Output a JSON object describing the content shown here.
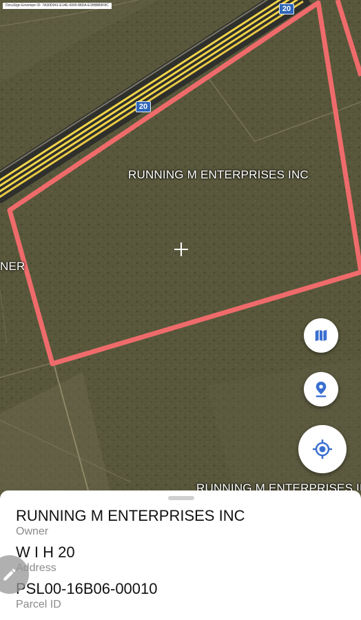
{
  "map": {
    "docusign_text": "DocuSign Envelope ID: 7A30D941-E14E-4300-88DA-E1B8B89F8C",
    "parcel_owner_main": "RUNNING M ENTERPRISES INC",
    "parcel_owner_left_partial": "NER",
    "parcel_owner_bottom_partial": "RUNNING M ENTERPRISES INC",
    "highway_top": "20",
    "highway_mid": "20",
    "colors": {
      "parcel_outline": "#ef6b6b",
      "road": "#f1d54a",
      "accent": "#2f66b8"
    }
  },
  "buttons": {
    "map_layers_icon": "map-icon",
    "pin_icon": "location-pin-icon",
    "locate_icon": "my-location-icon",
    "edit_icon": "pencil-icon"
  },
  "sheet": {
    "owner_value": "RUNNING M ENTERPRISES INC",
    "owner_label": "Owner",
    "address_value": "W I H 20",
    "address_label": "Address",
    "parcel_value": "PSL00-16B06-00010",
    "parcel_label": "Parcel ID"
  }
}
